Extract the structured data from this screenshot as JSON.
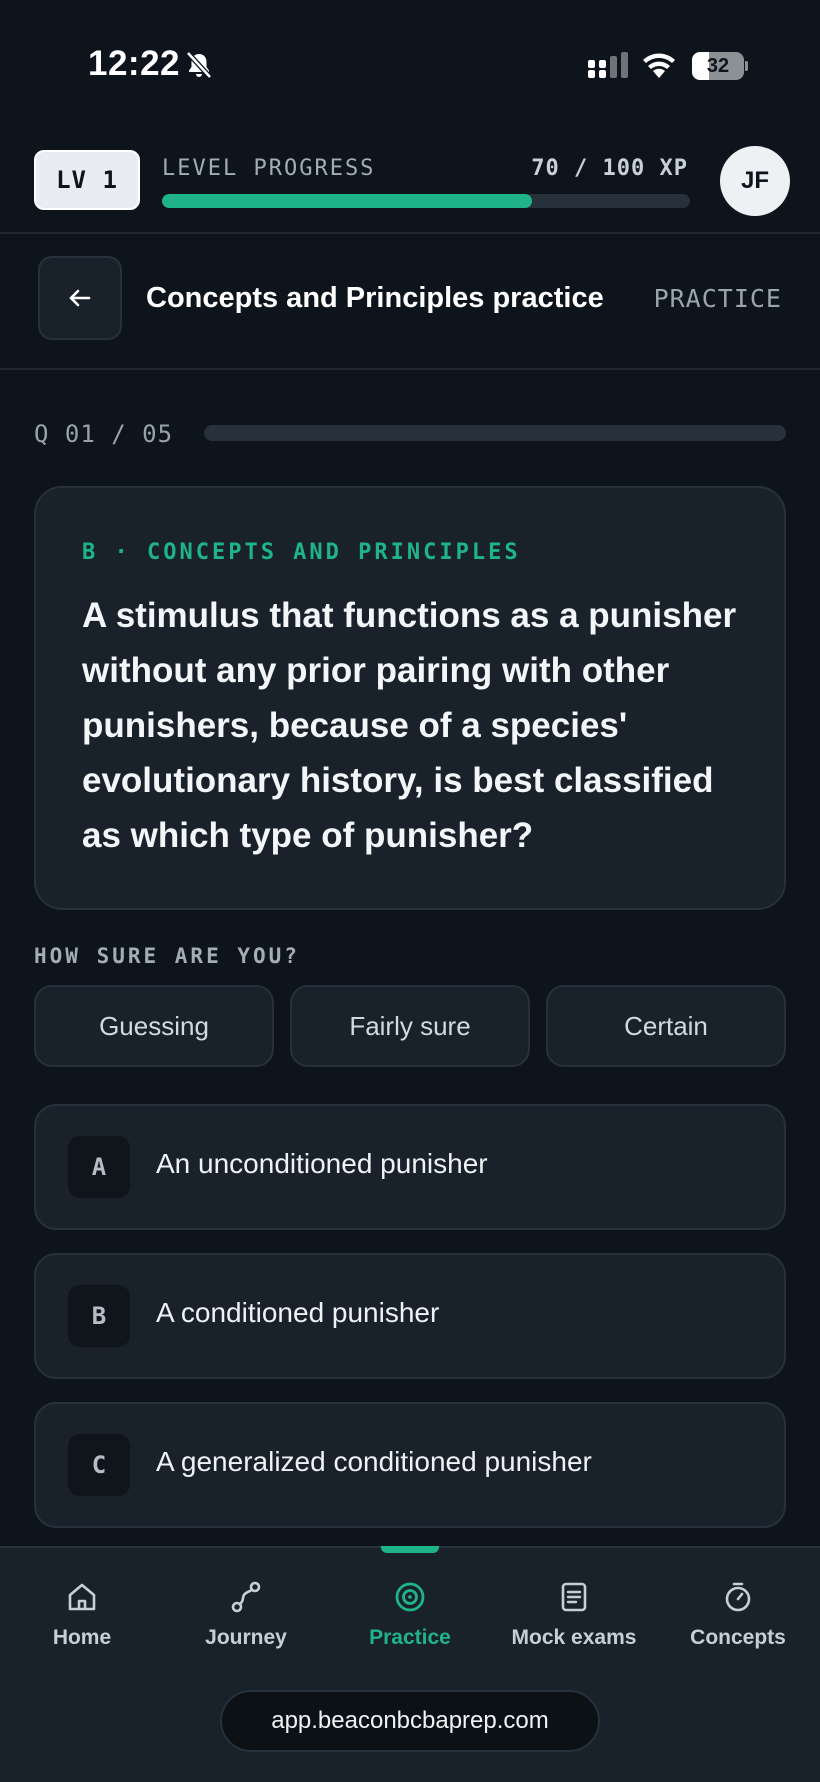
{
  "status_bar": {
    "time": "12:22",
    "battery": "32",
    "battery_level": 0.32
  },
  "level": {
    "badge": "LV 1",
    "title": "LEVEL PROGRESS",
    "xp_text": "70 / 100 XP",
    "progress": 0.7,
    "avatar_initials": "JF"
  },
  "header": {
    "title": "Concepts and Principles practice",
    "mode": "PRACTICE"
  },
  "quiz": {
    "counter": "Q 01 / 05",
    "progress": 0.0,
    "domain": "B · CONCEPTS AND PRINCIPLES",
    "question": "A stimulus that functions as a punisher without any prior pairing with other punishers, because of a species' evolutionary history, is best classified as which type of punisher?"
  },
  "confidence": {
    "title": "HOW SURE ARE YOU?",
    "options": [
      "Guessing",
      "Fairly sure",
      "Certain"
    ]
  },
  "answers": [
    {
      "letter": "A",
      "text": "An unconditioned punisher"
    },
    {
      "letter": "B",
      "text": "A conditioned punisher"
    },
    {
      "letter": "C",
      "text": "A generalized conditioned punisher"
    }
  ],
  "nav": {
    "items": [
      {
        "label": "Home",
        "icon": "home-icon"
      },
      {
        "label": "Journey",
        "icon": "route-icon"
      },
      {
        "label": "Practice",
        "icon": "target-icon",
        "active": true
      },
      {
        "label": "Mock exams",
        "icon": "document-icon"
      },
      {
        "label": "Concepts",
        "icon": "stopwatch-icon"
      }
    ]
  },
  "browser": {
    "url": "app.beaconbcbaprep.com"
  },
  "colors": {
    "accent": "#1fb487",
    "background": "#0e141b",
    "card": "#19222b"
  }
}
